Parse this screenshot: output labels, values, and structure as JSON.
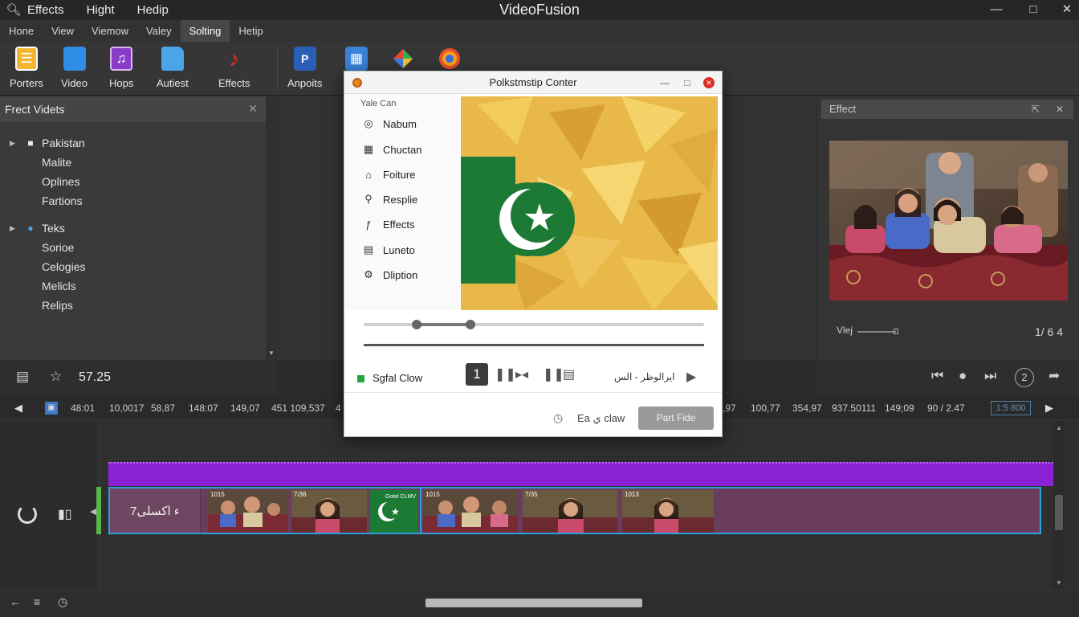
{
  "app": {
    "title": "VideoFusion",
    "title_menus": [
      "Effects",
      "Hight",
      "Hedip"
    ]
  },
  "menubar": [
    "Hone",
    "View",
    "Viemow",
    "Valey",
    "Solting",
    "Hetip"
  ],
  "menubar_active_index": 4,
  "ribbon": [
    {
      "label": "Porters",
      "icon": "notes-icon"
    },
    {
      "label": "Video",
      "icon": "video-file-icon"
    },
    {
      "label": "Hops",
      "icon": "music-doc-icon"
    },
    {
      "label": "Autiest",
      "icon": "folder-icon"
    },
    {
      "label": "Effects",
      "icon": "music-note-icon"
    },
    {
      "label": "Anpoits",
      "icon": "presentation-icon"
    },
    {
      "label": "",
      "icon": "document-icon"
    },
    {
      "label": "",
      "icon": "color-gem-icon"
    },
    {
      "label": "",
      "icon": "browser-icon"
    }
  ],
  "left_panel": {
    "title": "Frect Videts",
    "groups": [
      {
        "label": "Pakistan",
        "icon": "user-group-icon",
        "children": [
          "Malite",
          "Oplines",
          "Fartions"
        ]
      },
      {
        "label": "Teks",
        "icon": "cloud-icon",
        "children": [
          "Sorioe",
          "Celogies",
          "Melicls",
          "Relips"
        ]
      }
    ],
    "toolbar_value": "57.25"
  },
  "right_panel": {
    "title": "Effect",
    "volume_label": "Vlej",
    "counter": "1/ 6 4"
  },
  "ruler": {
    "left_ticks": [
      "48:01",
      "10,0017",
      "58,87",
      "148:07",
      "149,07",
      "451 109,537",
      "4"
    ],
    "right_ticks": [
      ",97",
      "100,77",
      "354,97",
      "937.50111",
      "149;09",
      "90 / 2.47"
    ],
    "box_value": "1:5 800"
  },
  "timeline": {
    "title_clip": "7ء اکسلی",
    "clips": [
      "1015",
      "7/36",
      "1015",
      "7/35",
      "1013"
    ],
    "green_clip_label": "Gotel CLMV"
  },
  "dialog": {
    "title": "Polkstmstip Conter",
    "sidebar_caption": "Yale Can",
    "items": [
      {
        "label": "Nabum",
        "icon": "scan-icon"
      },
      {
        "label": "Chuctan",
        "icon": "grid-icon"
      },
      {
        "label": "Foiture",
        "icon": "building-icon"
      },
      {
        "label": "Resplie",
        "icon": "search-icon"
      },
      {
        "label": "Effects",
        "icon": "feather-icon"
      },
      {
        "label": "Luneto",
        "icon": "list-icon"
      },
      {
        "label": "Dliption",
        "icon": "gear-icon"
      }
    ],
    "slider": {
      "low": 0.15,
      "high": 0.31
    },
    "status_label": "Sgfal Clow",
    "number_button": "1",
    "arabic_label": "ایرالوظر - الس",
    "footer_label": "Ea ي claw",
    "ok_button": "Part Fide"
  },
  "colors": {
    "accent_purple": "#8a22d4",
    "clip_blue": "#2d9ee0",
    "flag_green": "#1c7a35"
  }
}
